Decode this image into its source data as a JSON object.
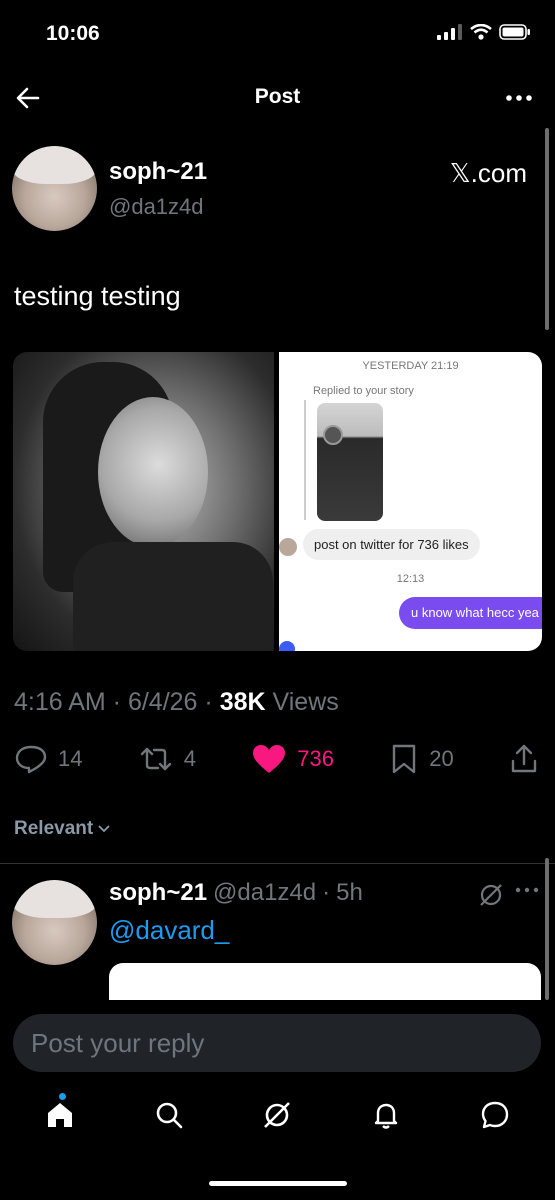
{
  "status_bar": {
    "time": "10:06"
  },
  "header": {
    "title": "Post"
  },
  "post": {
    "author_name": "soph~21",
    "author_handle": "@da1z4d",
    "source": "𝕏.com",
    "text": "testing testing",
    "time": "4:16 AM",
    "date": "6/4/26",
    "views": "38K",
    "views_label": "Views",
    "replies": "14",
    "reposts": "4",
    "likes": "736",
    "bookmarks": "20"
  },
  "media_right": {
    "timestamp1": "YESTERDAY 21:19",
    "replied_label": "Replied to your story",
    "incoming_message": "post on twitter for 736 likes",
    "timestamp2": "12:13",
    "outgoing_message": "u know what hecc yea"
  },
  "filter": {
    "label": "Relevant"
  },
  "reply": {
    "author_name": "soph~21",
    "author_handle": "@da1z4d",
    "age": "5h",
    "mention": "@davard_"
  },
  "composer": {
    "placeholder": "Post your reply"
  },
  "colors": {
    "like": "#f91880",
    "link": "#1d9bf0",
    "dm_bubble": "#7a4cf0"
  }
}
